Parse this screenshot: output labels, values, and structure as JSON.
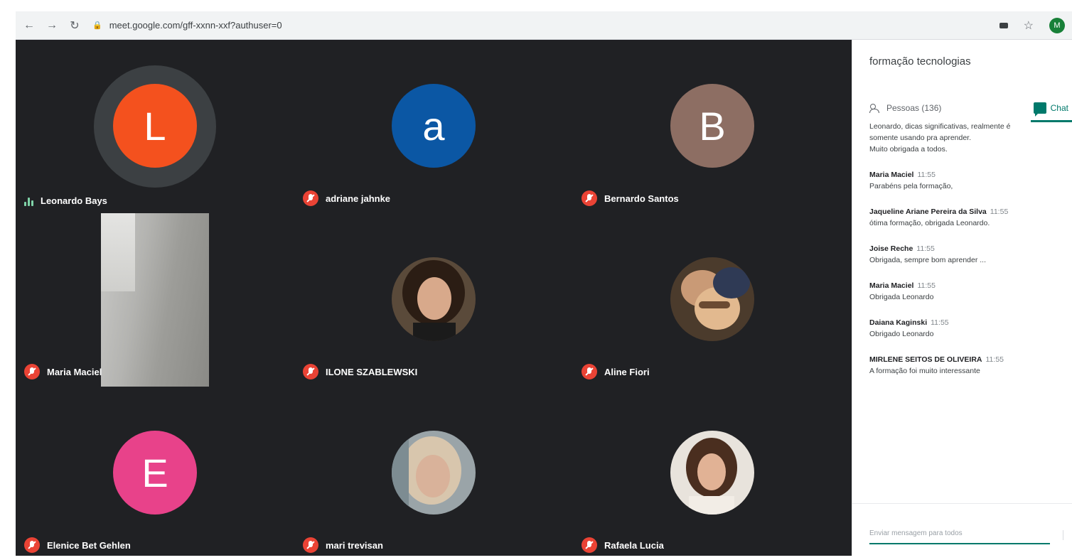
{
  "browser": {
    "url": "meet.google.com/gff-xxnn-xxf?authuser=0",
    "profile_initial": "M"
  },
  "participants": [
    {
      "name": "Leonardo Bays",
      "initial": "L",
      "avatar_color": "#f4511e",
      "speaking": true
    },
    {
      "name": "adriane jahnke",
      "initial": "a",
      "avatar_color": "#0b57a4",
      "muted": true
    },
    {
      "name": "Bernardo Santos",
      "initial": "B",
      "avatar_color": "#8d6e63",
      "muted": true
    },
    {
      "name": "Maria Maciel",
      "muted": true,
      "camera_on": true
    },
    {
      "name": "ILONE SZABLEWSKI",
      "muted": true,
      "photo": true
    },
    {
      "name": "Aline Fiori",
      "muted": true,
      "photo": true
    },
    {
      "name": "Elenice Bet Gehlen",
      "initial": "E",
      "avatar_color": "#e8428a",
      "muted": true
    },
    {
      "name": "mari trevisan",
      "muted": true,
      "photo": true
    },
    {
      "name": "Rafaela Lucia",
      "muted": true,
      "photo": true
    }
  ],
  "panel": {
    "meeting_title": "formação tecnologias",
    "people_tab": "Pessoas (136)",
    "chat_tab": "Chat",
    "continued_message": [
      "Leonardo, dicas significativas, realmente é",
      "somente usando pra aprender.",
      "Muito obrigada a todos."
    ],
    "messages": [
      {
        "sender": "Maria Maciel",
        "time": "11:55",
        "text": "Parabéns pela formação,"
      },
      {
        "sender": "Jaqueline Ariane Pereira da Silva",
        "time": "11:55",
        "text": "ótima formação, obrigada Leonardo."
      },
      {
        "sender": "Joise Reche",
        "time": "11:55",
        "text": "Obrigada, sempre bom aprender ..."
      },
      {
        "sender": "Maria Maciel",
        "time": "11:55",
        "text": "Obrigada Leonardo"
      },
      {
        "sender": "Daiana Kaginski",
        "time": "11:55",
        "text": "Obrigado Leonardo"
      },
      {
        "sender": "MIRLENE SEITOS DE OLIVEIRA",
        "time": "11:55",
        "text": "A formação foi muito interessante"
      }
    ],
    "compose_placeholder": "Enviar mensagem para todos"
  },
  "colors": {
    "meet_background": "#202124",
    "accent": "#00796b",
    "muted_red": "#ea4335"
  }
}
